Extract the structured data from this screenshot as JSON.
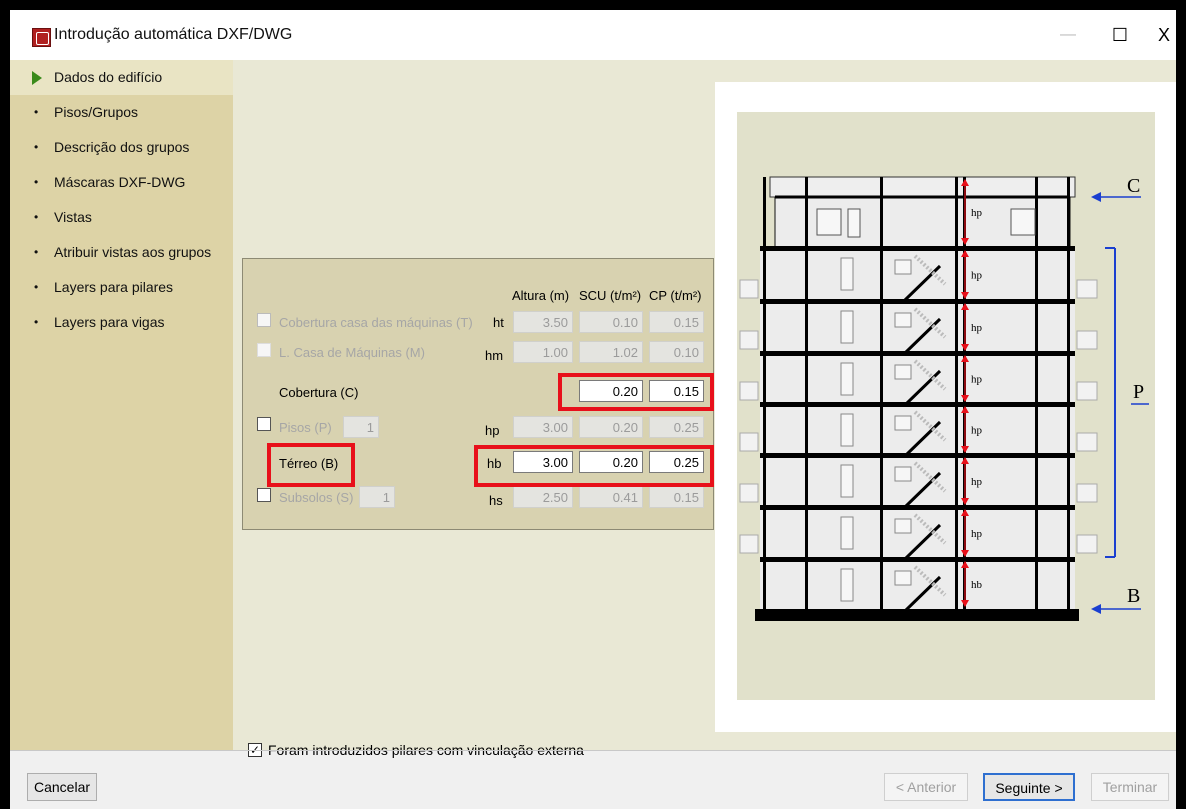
{
  "window": {
    "title": "Introdução automática DXF/DWG",
    "minimize_glyph": "—",
    "maximize_glyph": "☐",
    "close_glyph": "X"
  },
  "sidebar": {
    "items": [
      {
        "label": "Dados do edifício",
        "active": true
      },
      {
        "label": "Pisos/Grupos"
      },
      {
        "label": "Descrição dos grupos"
      },
      {
        "label": "Máscaras DXF-DWG"
      },
      {
        "label": "Vistas"
      },
      {
        "label": "Atribuir vistas aos grupos"
      },
      {
        "label": "Layers para pilares"
      },
      {
        "label": "Layers para vigas"
      }
    ]
  },
  "table": {
    "headers": {
      "altura": "Altura (m)",
      "scu": "SCU (t/m²)",
      "cp": "CP (t/m²)"
    },
    "rows": {
      "cobertura_maquinas": {
        "label": "Cobertura casa das máquinas (T)",
        "code": "ht",
        "altura": "3.50",
        "scu": "0.10",
        "cp": "0.15"
      },
      "casa_maquinas": {
        "label": "L. Casa de Máquinas (M)",
        "code": "hm",
        "altura": "1.00",
        "scu": "1.02",
        "cp": "0.10"
      },
      "cobertura": {
        "label": "Cobertura (C)",
        "scu": "0.20",
        "cp": "0.15"
      },
      "pisos": {
        "label": "Pisos (P)",
        "count": "1",
        "code": "hp",
        "altura": "3.00",
        "scu": "0.20",
        "cp": "0.25"
      },
      "terreo": {
        "label": "Térreo (B)",
        "code": "hb",
        "altura": "3.00",
        "scu": "0.20",
        "cp": "0.25"
      },
      "subsolos": {
        "label": "Subsolos (S)",
        "count": "1",
        "code": "hs",
        "altura": "2.50",
        "scu": "0.41",
        "cp": "0.15"
      }
    }
  },
  "diagram": {
    "labels": {
      "c": "C",
      "p": "P",
      "b": "B"
    },
    "floor_height_label": "hp",
    "ground_height_label": "hb",
    "floors_count": 7,
    "highlight_color": "#e8101a",
    "marker_color": "#1a3fd0"
  },
  "footer": {
    "checkbox_label": "Foram introduzidos pilares com vinculação externa",
    "checkbox_checked": true,
    "check_glyph": "✓",
    "cancel": "Cancelar",
    "back": "< Anterior",
    "next": "Seguinte >",
    "finish": "Terminar"
  }
}
